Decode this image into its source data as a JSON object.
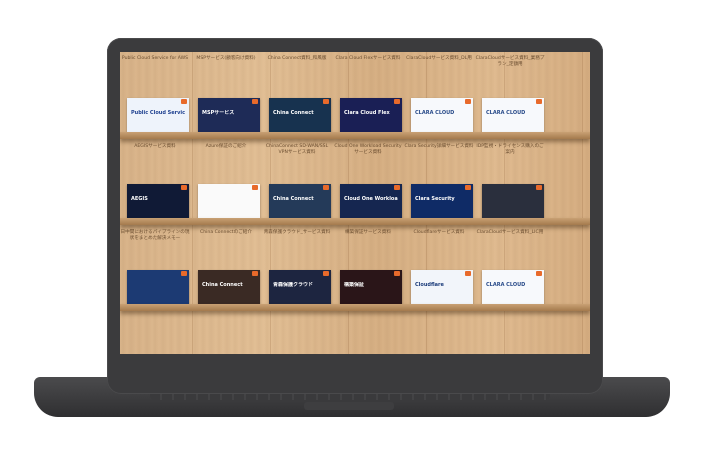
{
  "shelves": [
    {
      "items": [
        {
          "label": "Public Cloud Service for AWS",
          "thumb_text": "Public Cloud Service for AWS",
          "thumb_bg": "#eef3fb",
          "text_color": "#1d3f8f"
        },
        {
          "label": "MSPサービス(顧客向け資料)",
          "thumb_text": "MSPサービス",
          "thumb_bg": "#1e2b57",
          "text_color": "#ffffff"
        },
        {
          "label": "China Connect資料_和風版",
          "thumb_text": "China Connect",
          "thumb_bg": "#17324f",
          "text_color": "#ffffff"
        },
        {
          "label": "Clara Cloud Flexサービス資料",
          "thumb_text": "Clara Cloud Flex",
          "thumb_bg": "#1a1f55",
          "text_color": "#ffffff"
        },
        {
          "label": "ClaraCloudサービス資料_DL用",
          "thumb_text": "CLARA CLOUD",
          "thumb_bg": "#f7f9fc",
          "text_color": "#2a4c8a"
        },
        {
          "label": "ClaraCloudサービス資料_業務プラン_定額用",
          "thumb_text": "CLARA CLOUD",
          "thumb_bg": "#f7f9fc",
          "text_color": "#2a4c8a"
        }
      ]
    },
    {
      "items": [
        {
          "label": "AEGISサービス資料",
          "thumb_text": "AEGIS",
          "thumb_bg": "#101a36",
          "text_color": "#ffffff"
        },
        {
          "label": "Azure保証のご紹介",
          "thumb_text": "",
          "thumb_bg": "#fafafa",
          "text_color": "#333333"
        },
        {
          "label": "ChinaConnect SD-WAN/SSL VPNサービス資料",
          "thumb_text": "China Connect",
          "thumb_bg": "#243a59",
          "text_color": "#ffffff"
        },
        {
          "label": "Cloud One Workload Security サービス資料",
          "thumb_text": "Cloud One Workload Security",
          "thumb_bg": "#152650",
          "text_color": "#ffffff"
        },
        {
          "label": "Clara Security詳細サービス資料",
          "thumb_text": "Clara Security",
          "thumb_bg": "#0f2b66",
          "text_color": "#ffffff"
        },
        {
          "label": "IDP監視・ドライセンス購入のご案内",
          "thumb_text": "",
          "thumb_bg": "#2a2f3d",
          "text_color": "#ffffff"
        }
      ]
    },
    {
      "items": [
        {
          "label": "日中間におけるパイプラインの現状をまとめた解決メモー",
          "thumb_text": "",
          "thumb_bg": "#1c3a73",
          "text_color": "#ffffff"
        },
        {
          "label": "China Connectのご紹介",
          "thumb_text": "China Connect",
          "thumb_bg": "#3a2a24",
          "text_color": "#ffffff"
        },
        {
          "label": "青森保護クラウド_サービス資料",
          "thumb_text": "青森保護クラウド",
          "thumb_bg": "#1d2540",
          "text_color": "#ffffff"
        },
        {
          "label": "構築保証サービス資料",
          "thumb_text": "構築保証",
          "thumb_bg": "#2a1518",
          "text_color": "#ffffff"
        },
        {
          "label": "Cloudflareサービス資料",
          "thumb_text": "Cloudflare",
          "thumb_bg": "#f2f5fa",
          "text_color": "#1b3b7a"
        },
        {
          "label": "ClaraCloudサービス資料_LIC用",
          "thumb_text": "CLARA CLOUD",
          "thumb_bg": "#f7f9fc",
          "text_color": "#2a4c8a"
        }
      ]
    }
  ]
}
